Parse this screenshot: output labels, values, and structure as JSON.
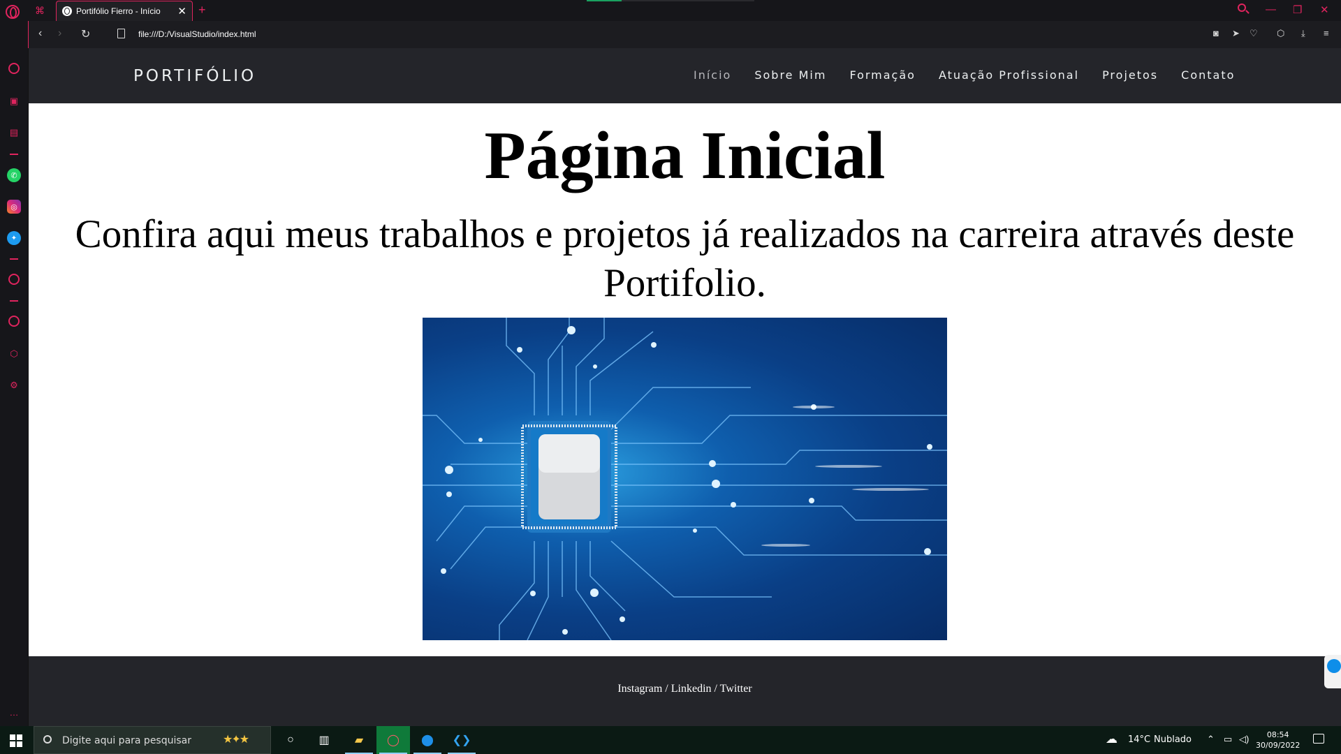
{
  "browser": {
    "tab_title": "Portifólio Fierro - Início",
    "tab_close": "✕",
    "new_tab": "+",
    "url": "file:///D:/VisualStudio/index.html",
    "accent_color": "#e0245e"
  },
  "site": {
    "brand": "PORTIFÓLIO",
    "nav": [
      {
        "label": "Início",
        "active": true
      },
      {
        "label": "Sobre Mim",
        "active": false
      },
      {
        "label": "Formação",
        "active": false
      },
      {
        "label": "Atuação Profissional",
        "active": false
      },
      {
        "label": "Projetos",
        "active": false
      },
      {
        "label": "Contato",
        "active": false
      }
    ],
    "heading": "Página Inicial",
    "subheading": "Confira aqui meus trabalhos e projetos já realizados na carreira através deste Portifolio.",
    "hero_image_icon": "circuit-chip-image",
    "footer_links": "Instagram / Linkedin / Twitter",
    "header_bg": "#24252a"
  },
  "taskbar": {
    "search_placeholder": "Digite aqui para pesquisar",
    "weather_temp": "14°C",
    "weather_desc": "Nublado",
    "time": "08:54",
    "date": "30/09/2022"
  }
}
